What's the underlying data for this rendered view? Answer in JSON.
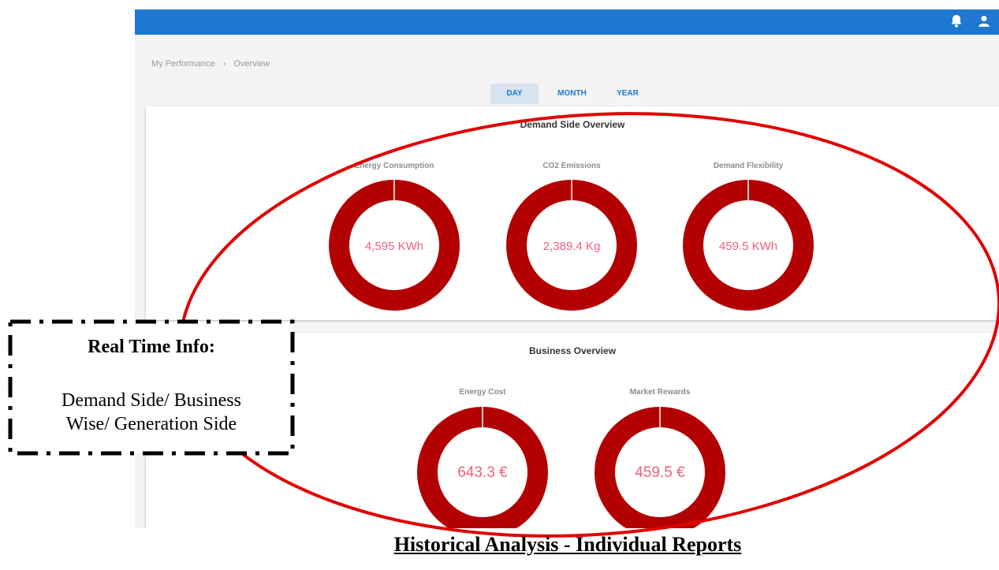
{
  "header": {
    "bell_icon": "bell-icon",
    "user_icon": "user-icon"
  },
  "breadcrumb": {
    "items": [
      "My Performance",
      "Overview"
    ],
    "separator": "›"
  },
  "tabs": [
    {
      "label": "DAY",
      "active": true
    },
    {
      "label": "MONTH",
      "active": false
    },
    {
      "label": "YEAR",
      "active": false
    }
  ],
  "demand": {
    "title": "Demand Side Overview",
    "gauges": [
      {
        "label": "Energy Consumption",
        "value": "4,595 KWh"
      },
      {
        "label": "CO2 Emissions",
        "value": "2,389.4 Kg"
      },
      {
        "label": "Demand Flexibility",
        "value": "459.5 KWh"
      }
    ]
  },
  "business": {
    "title": "Business Overview",
    "gauges": [
      {
        "label": "Energy Cost",
        "value": "643.3 €"
      },
      {
        "label": "Market Rewards",
        "value": "459.5 €"
      }
    ]
  },
  "annotation": {
    "callout_title": "Real Time Info:",
    "callout_lines": [
      "Demand Side/ Business",
      "Wise/ Generation Side"
    ],
    "caption": "Historical Analysis - Individual Reports"
  },
  "colors": {
    "topbar": "#1e78d2",
    "ring": "#b30000",
    "value_text": "#f0607a",
    "highlight": "#e00000"
  }
}
